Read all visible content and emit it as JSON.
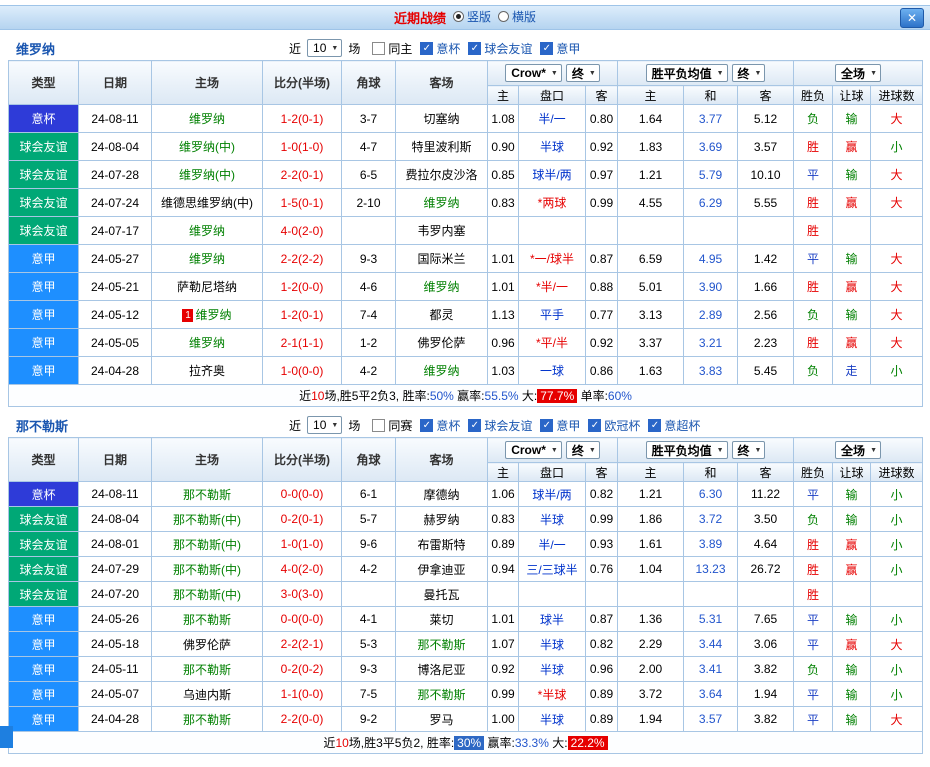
{
  "titlebar": {
    "title": "近期战绩",
    "radios": [
      {
        "label": "竖版",
        "selected": true
      },
      {
        "label": "横版",
        "selected": false
      }
    ]
  },
  "icons": {
    "dropdown": "▼",
    "check": "✓",
    "close": "✕"
  },
  "colors": {
    "accent_blue": "#1a56b0",
    "badge_cup": "#2e3bd8",
    "badge_friendly": "#00a876",
    "badge_serie_a": "#1e8fff",
    "win_red": "#e60000",
    "draw_blue": "#1a3fc4",
    "lose_green": "#008000"
  },
  "table_head": {
    "type": "类型",
    "date": "日期",
    "home": "主场",
    "score": "比分(半场)",
    "corner": "角球",
    "away": "客场",
    "asia_select": "Crow*",
    "asia_final": "终",
    "asia_sub": [
      "主",
      "盘口",
      "客"
    ],
    "europe_select": "胜平负均值",
    "europe_final": "终",
    "europe_sub": [
      "主",
      "和",
      "客"
    ],
    "scope_select": "全场",
    "result_sub": [
      "胜负",
      "让球",
      "进球数"
    ]
  },
  "sections": [
    {
      "team": "维罗纳",
      "filter": {
        "near": "近",
        "count": "10",
        "games": "场",
        "checks": [
          {
            "label": "同主",
            "checked": false
          },
          {
            "label": "意杯",
            "checked": true
          },
          {
            "label": "球会友谊",
            "checked": true
          },
          {
            "label": "意甲",
            "checked": true
          }
        ]
      },
      "rows": [
        {
          "type": "意杯",
          "date": "24-08-11",
          "home": "维罗纳",
          "hf": true,
          "score": "1-2(0-1)",
          "corner": "3-7",
          "away": "切塞纳",
          "h": "1.08",
          "hc": "半/一",
          "a": "0.80",
          "eh": "1.64",
          "ed": "3.77",
          "ea": "5.12",
          "wdl": "负",
          "let": "输",
          "goal": "大"
        },
        {
          "type": "球会友谊",
          "date": "24-08-04",
          "home": "维罗纳(中)",
          "hf": true,
          "score": "1-0(1-0)",
          "corner": "4-7",
          "away": "特里波利斯",
          "h": "0.90",
          "hc": "半球",
          "a": "0.92",
          "eh": "1.83",
          "ed": "3.69",
          "ea": "3.57",
          "wdl": "胜",
          "let": "赢",
          "goal": "小"
        },
        {
          "type": "球会友谊",
          "date": "24-07-28",
          "home": "维罗纳(中)",
          "hf": true,
          "score": "2-2(0-1)",
          "corner": "6-5",
          "away": "费拉尔皮沙洛",
          "h": "0.85",
          "hc": "球半/两",
          "a": "0.97",
          "eh": "1.21",
          "ed": "5.79",
          "ea": "10.10",
          "wdl": "平",
          "let": "输",
          "goal": "大"
        },
        {
          "type": "球会友谊",
          "date": "24-07-24",
          "home": "维德思维罗纳(中)",
          "score": "1-5(0-1)",
          "corner": "2-10",
          "away": "维罗纳",
          "af": true,
          "h": "0.83",
          "hc": "*两球",
          "a": "0.99",
          "eh": "4.55",
          "ed": "6.29",
          "ea": "5.55",
          "wdl": "胜",
          "let": "赢",
          "goal": "大"
        },
        {
          "type": "球会友谊",
          "date": "24-07-17",
          "home": "维罗纳",
          "hf": true,
          "score": "4-0(2-0)",
          "corner": "",
          "away": "韦罗内塞",
          "wdl": "胜"
        },
        {
          "type": "意甲",
          "date": "24-05-27",
          "home": "维罗纳",
          "hf": true,
          "score": "2-2(2-2)",
          "corner": "9-3",
          "away": "国际米兰",
          "h": "1.01",
          "hc": "*一/球半",
          "a": "0.87",
          "eh": "6.59",
          "ed": "4.95",
          "ea": "1.42",
          "wdl": "平",
          "let": "输",
          "goal": "大"
        },
        {
          "type": "意甲",
          "date": "24-05-21",
          "home": "萨勒尼塔纳",
          "score": "1-2(0-0)",
          "corner": "4-6",
          "away": "维罗纳",
          "af": true,
          "h": "1.01",
          "hc": "*半/一",
          "a": "0.88",
          "eh": "5.01",
          "ed": "3.90",
          "ea": "1.66",
          "wdl": "胜",
          "let": "赢",
          "goal": "大"
        },
        {
          "type": "意甲",
          "date": "24-05-12",
          "home": "维罗纳",
          "hf": true,
          "home_card": "1",
          "score": "1-2(0-1)",
          "corner": "7-4",
          "away": "都灵",
          "h": "1.13",
          "hc": "平手",
          "a": "0.77",
          "eh": "3.13",
          "ed": "2.89",
          "ea": "2.56",
          "wdl": "负",
          "let": "输",
          "goal": "大"
        },
        {
          "type": "意甲",
          "date": "24-05-05",
          "home": "维罗纳",
          "hf": true,
          "score": "2-1(1-1)",
          "corner": "1-2",
          "away": "佛罗伦萨",
          "h": "0.96",
          "hc": "*平/半",
          "a": "0.92",
          "eh": "3.37",
          "ed": "3.21",
          "ea": "2.23",
          "wdl": "胜",
          "let": "赢",
          "goal": "大"
        },
        {
          "type": "意甲",
          "date": "24-04-28",
          "home": "拉齐奥",
          "score": "1-0(0-0)",
          "corner": "4-2",
          "away": "维罗纳",
          "af": true,
          "h": "1.03",
          "hc": "一球",
          "a": "0.86",
          "eh": "1.63",
          "ed": "3.83",
          "ea": "5.45",
          "wdl": "负",
          "let": "走",
          "goal": "小"
        }
      ],
      "summary": [
        {
          "text": "近",
          "style": "plain"
        },
        {
          "text": "10",
          "style": "red"
        },
        {
          "text": "场,胜5平2负3, 胜率:",
          "style": "plain"
        },
        {
          "text": "50%",
          "style": "blue"
        },
        {
          "text": " 赢率:",
          "style": "plain"
        },
        {
          "text": "55.5%",
          "style": "blue"
        },
        {
          "text": " 大:",
          "style": "plain"
        },
        {
          "text": "77.7%",
          "style": "redbg"
        },
        {
          "text": " 单率:",
          "style": "plain"
        },
        {
          "text": "60%",
          "style": "blue"
        }
      ]
    },
    {
      "team": "那不勒斯",
      "filter": {
        "near": "近",
        "count": "10",
        "games": "场",
        "checks": [
          {
            "label": "同赛",
            "checked": false
          },
          {
            "label": "意杯",
            "checked": true
          },
          {
            "label": "球会友谊",
            "checked": true
          },
          {
            "label": "意甲",
            "checked": true
          },
          {
            "label": "欧冠杯",
            "checked": true
          },
          {
            "label": "意超杯",
            "checked": true
          }
        ]
      },
      "rows": [
        {
          "type": "意杯",
          "date": "24-08-11",
          "home": "那不勒斯",
          "hf": true,
          "score": "0-0(0-0)",
          "corner": "6-1",
          "away": "摩德纳",
          "h": "1.06",
          "hc": "球半/两",
          "a": "0.82",
          "eh": "1.21",
          "ed": "6.30",
          "ea": "11.22",
          "wdl": "平",
          "let": "输",
          "goal": "小"
        },
        {
          "type": "球会友谊",
          "date": "24-08-04",
          "home": "那不勒斯(中)",
          "hf": true,
          "score": "0-2(0-1)",
          "corner": "5-7",
          "away": "赫罗纳",
          "h": "0.83",
          "hc": "半球",
          "a": "0.99",
          "eh": "1.86",
          "ed": "3.72",
          "ea": "3.50",
          "wdl": "负",
          "let": "输",
          "goal": "小"
        },
        {
          "type": "球会友谊",
          "date": "24-08-01",
          "home": "那不勒斯(中)",
          "hf": true,
          "score": "1-0(1-0)",
          "corner": "9-6",
          "away": "布雷斯特",
          "h": "0.89",
          "hc": "半/一",
          "a": "0.93",
          "eh": "1.61",
          "ed": "3.89",
          "ea": "4.64",
          "wdl": "胜",
          "let": "赢",
          "goal": "小"
        },
        {
          "type": "球会友谊",
          "date": "24-07-29",
          "home": "那不勒斯(中)",
          "hf": true,
          "score": "4-0(2-0)",
          "corner": "4-2",
          "away": "伊拿迪亚",
          "h": "0.94",
          "hc": "三/三球半",
          "a": "0.76",
          "eh": "1.04",
          "ed": "13.23",
          "ea": "26.72",
          "wdl": "胜",
          "let": "赢",
          "goal": "小"
        },
        {
          "type": "球会友谊",
          "date": "24-07-20",
          "home": "那不勒斯(中)",
          "hf": true,
          "score": "3-0(3-0)",
          "corner": "",
          "away": "曼托瓦",
          "wdl": "胜"
        },
        {
          "type": "意甲",
          "date": "24-05-26",
          "home": "那不勒斯",
          "hf": true,
          "score": "0-0(0-0)",
          "corner": "4-1",
          "away": "莱切",
          "h": "1.01",
          "hc": "球半",
          "a": "0.87",
          "eh": "1.36",
          "ed": "5.31",
          "ea": "7.65",
          "wdl": "平",
          "let": "输",
          "goal": "小"
        },
        {
          "type": "意甲",
          "date": "24-05-18",
          "home": "佛罗伦萨",
          "score": "2-2(2-1)",
          "corner": "5-3",
          "away": "那不勒斯",
          "af": true,
          "h": "1.07",
          "hc": "半球",
          "a": "0.82",
          "eh": "2.29",
          "ed": "3.44",
          "ea": "3.06",
          "wdl": "平",
          "let": "赢",
          "goal": "大"
        },
        {
          "type": "意甲",
          "date": "24-05-11",
          "home": "那不勒斯",
          "hf": true,
          "score": "0-2(0-2)",
          "corner": "9-3",
          "away": "博洛尼亚",
          "h": "0.92",
          "hc": "半球",
          "a": "0.96",
          "eh": "2.00",
          "ed": "3.41",
          "ea": "3.82",
          "wdl": "负",
          "let": "输",
          "goal": "小"
        },
        {
          "type": "意甲",
          "date": "24-05-07",
          "home": "乌迪内斯",
          "score": "1-1(0-0)",
          "corner": "7-5",
          "away": "那不勒斯",
          "af": true,
          "h": "0.99",
          "hc": "*半球",
          "a": "0.89",
          "eh": "3.72",
          "ed": "3.64",
          "ea": "1.94",
          "wdl": "平",
          "let": "输",
          "goal": "小"
        },
        {
          "type": "意甲",
          "date": "24-04-28",
          "home": "那不勒斯",
          "hf": true,
          "score": "2-2(0-0)",
          "corner": "9-2",
          "away": "罗马",
          "h": "1.00",
          "hc": "半球",
          "a": "0.89",
          "eh": "1.94",
          "ed": "3.57",
          "ea": "3.82",
          "wdl": "平",
          "let": "输",
          "goal": "大"
        }
      ],
      "summary": [
        {
          "text": "近",
          "style": "plain"
        },
        {
          "text": "10",
          "style": "red"
        },
        {
          "text": "场,胜3平5负2, 胜率:",
          "style": "plain"
        },
        {
          "text": "30%",
          "style": "bluebg"
        },
        {
          "text": " 赢率:",
          "style": "plain"
        },
        {
          "text": "33.3%",
          "style": "blue"
        },
        {
          "text": " 大:",
          "style": "plain"
        },
        {
          "text": "22.2%",
          "style": "redbg"
        }
      ]
    }
  ]
}
